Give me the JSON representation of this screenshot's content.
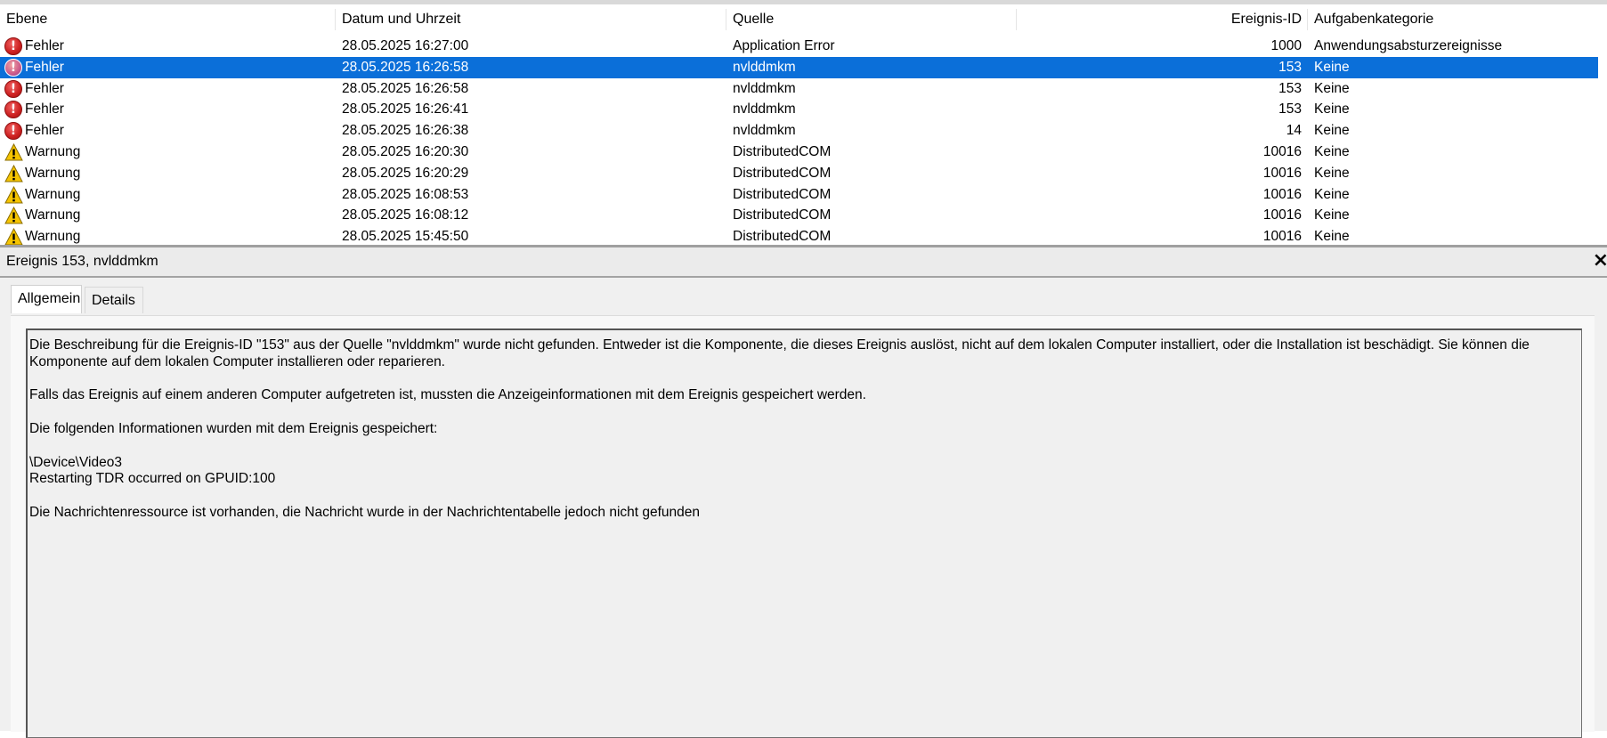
{
  "columns": {
    "level": "Ebene",
    "datetime": "Datum und Uhrzeit",
    "source": "Quelle",
    "event_id": "Ereignis-ID",
    "category": "Aufgabenkategorie"
  },
  "rows": [
    {
      "level": "Fehler",
      "level_type": "error-icon",
      "datetime": "28.05.2025 16:27:00",
      "source": "Application Error",
      "event_id": "1000",
      "category": "Anwendungsabsturzereignisse",
      "selected": false
    },
    {
      "level": "Fehler",
      "level_type": "error-icon",
      "datetime": "28.05.2025 16:26:58",
      "source": "nvlddmkm",
      "event_id": "153",
      "category": "Keine",
      "selected": true
    },
    {
      "level": "Fehler",
      "level_type": "error-icon",
      "datetime": "28.05.2025 16:26:58",
      "source": "nvlddmkm",
      "event_id": "153",
      "category": "Keine",
      "selected": false
    },
    {
      "level": "Fehler",
      "level_type": "error-icon",
      "datetime": "28.05.2025 16:26:41",
      "source": "nvlddmkm",
      "event_id": "153",
      "category": "Keine",
      "selected": false
    },
    {
      "level": "Fehler",
      "level_type": "error-icon",
      "datetime": "28.05.2025 16:26:38",
      "source": "nvlddmkm",
      "event_id": "14",
      "category": "Keine",
      "selected": false
    },
    {
      "level": "Warnung",
      "level_type": "warning-icon",
      "datetime": "28.05.2025 16:20:30",
      "source": "DistributedCOM",
      "event_id": "10016",
      "category": "Keine",
      "selected": false
    },
    {
      "level": "Warnung",
      "level_type": "warning-icon",
      "datetime": "28.05.2025 16:20:29",
      "source": "DistributedCOM",
      "event_id": "10016",
      "category": "Keine",
      "selected": false
    },
    {
      "level": "Warnung",
      "level_type": "warning-icon",
      "datetime": "28.05.2025 16:08:53",
      "source": "DistributedCOM",
      "event_id": "10016",
      "category": "Keine",
      "selected": false
    },
    {
      "level": "Warnung",
      "level_type": "warning-icon",
      "datetime": "28.05.2025 16:08:12",
      "source": "DistributedCOM",
      "event_id": "10016",
      "category": "Keine",
      "selected": false
    },
    {
      "level": "Warnung",
      "level_type": "warning-icon",
      "datetime": "28.05.2025 15:45:50",
      "source": "DistributedCOM",
      "event_id": "10016",
      "category": "Keine",
      "selected": false
    }
  ],
  "details": {
    "title": "Ereignis 153, nvlddmkm",
    "close_icon": "×",
    "tabs": [
      "Allgemein",
      "Details"
    ],
    "active_tab": "Allgemein",
    "description": [
      "Die Beschreibung für die Ereignis-ID \"153\" aus der Quelle \"nvlddmkm\" wurde nicht gefunden. Entweder ist die Komponente, die dieses Ereignis auslöst, nicht auf dem lokalen Computer installiert, oder die Installation ist beschädigt. Sie können die Komponente auf dem lokalen Computer installieren oder reparieren.",
      "",
      "Falls das Ereignis auf einem anderen Computer aufgetreten ist, mussten die Anzeigeinformationen mit dem Ereignis gespeichert werden.",
      "",
      "Die folgenden Informationen wurden mit dem Ereignis gespeichert:",
      "",
      "\\Device\\Video3",
      "Restarting TDR occurred on GPUID:100",
      "",
      "Die Nachrichtenressource ist vorhanden, die Nachricht wurde in der Nachrichtentabelle jedoch nicht gefunden"
    ]
  },
  "colors": {
    "selection": "#0b6fd9",
    "error": "#cc1f1f",
    "warning": "#f5c400"
  }
}
